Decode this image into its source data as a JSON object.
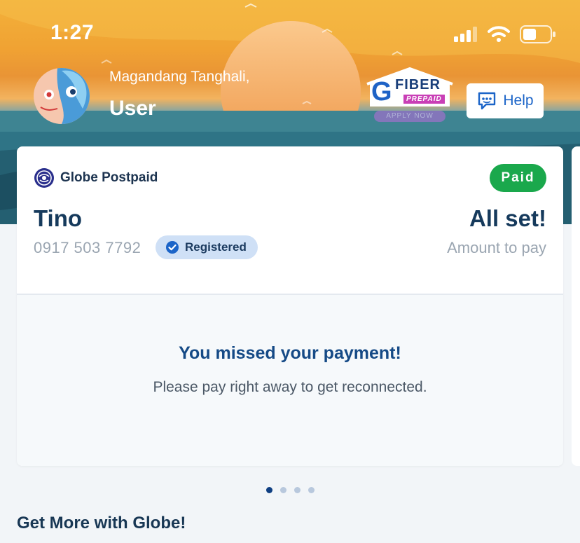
{
  "status_bar": {
    "time": "1:27"
  },
  "header": {
    "greeting": "Magandang Tanghali,",
    "username": "User",
    "promo": {
      "brand_letter": "G",
      "brand_word": "FIBER",
      "tag": "PREPAID",
      "cta": "APPLY NOW"
    },
    "help_label": "Help"
  },
  "account_card": {
    "brand": "Globe Postpaid",
    "status_badge": "Paid",
    "account_name": "Tino",
    "phone_number": "0917 503 7792",
    "registered_label": "Registered",
    "balance_title": "All set!",
    "balance_label": "Amount to pay",
    "alert_title": "You missed your payment!",
    "alert_message": "Please pay right away to get reconnected."
  },
  "carousel": {
    "page_count": 4,
    "active_index": 0
  },
  "section": {
    "title": "Get More with Globe!"
  },
  "colors": {
    "accent_blue": "#154a86",
    "paid_green": "#1aa84c",
    "registered_bg": "#cfe0f6",
    "help_blue": "#1b64c8"
  }
}
